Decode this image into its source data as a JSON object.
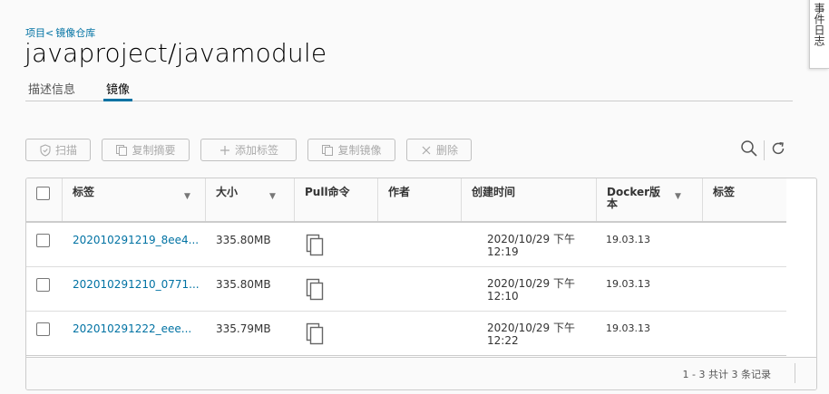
{
  "breadcrumb": {
    "project": "项目<",
    "repo": "镜像仓库"
  },
  "title": "javaproject/javamodule",
  "tabs": [
    {
      "label": "描述信息",
      "active": false
    },
    {
      "label": "镜像",
      "active": true
    }
  ],
  "side_panel": {
    "label": "事件日志"
  },
  "toolbar": {
    "scan": "扫描",
    "copy_digest": "复制摘要",
    "add_label": "添加标签",
    "copy_image": "复制镜像",
    "delete": "删除"
  },
  "table": {
    "headers": {
      "tag": "标签",
      "size": "大小",
      "pull": "Pull命令",
      "author": "作者",
      "created": "创建时间",
      "docker_line1": "Docker版",
      "docker_line2": "本",
      "labels": "标签"
    },
    "rows": [
      {
        "tag": "202010291219_8ee4...",
        "size": "335.80MB",
        "author": "",
        "created_line1": "2020/10/29 下午",
        "created_line2": "12:19",
        "docker": "19.03.13",
        "labels": ""
      },
      {
        "tag": "202010291210_0771...",
        "size": "335.80MB",
        "author": "",
        "created_line1": "2020/10/29 下午",
        "created_line2": "12:10",
        "docker": "19.03.13",
        "labels": ""
      },
      {
        "tag": "202010291222_eee...",
        "size": "335.79MB",
        "author": "",
        "created_line1": "2020/10/29 下午",
        "created_line2": "12:22",
        "docker": "19.03.13",
        "labels": ""
      }
    ],
    "footer": "1 - 3 共计 3 条记录"
  },
  "colors": {
    "accent": "#0072a3",
    "disabled": "#aaaaaa",
    "border": "#cccccc"
  }
}
